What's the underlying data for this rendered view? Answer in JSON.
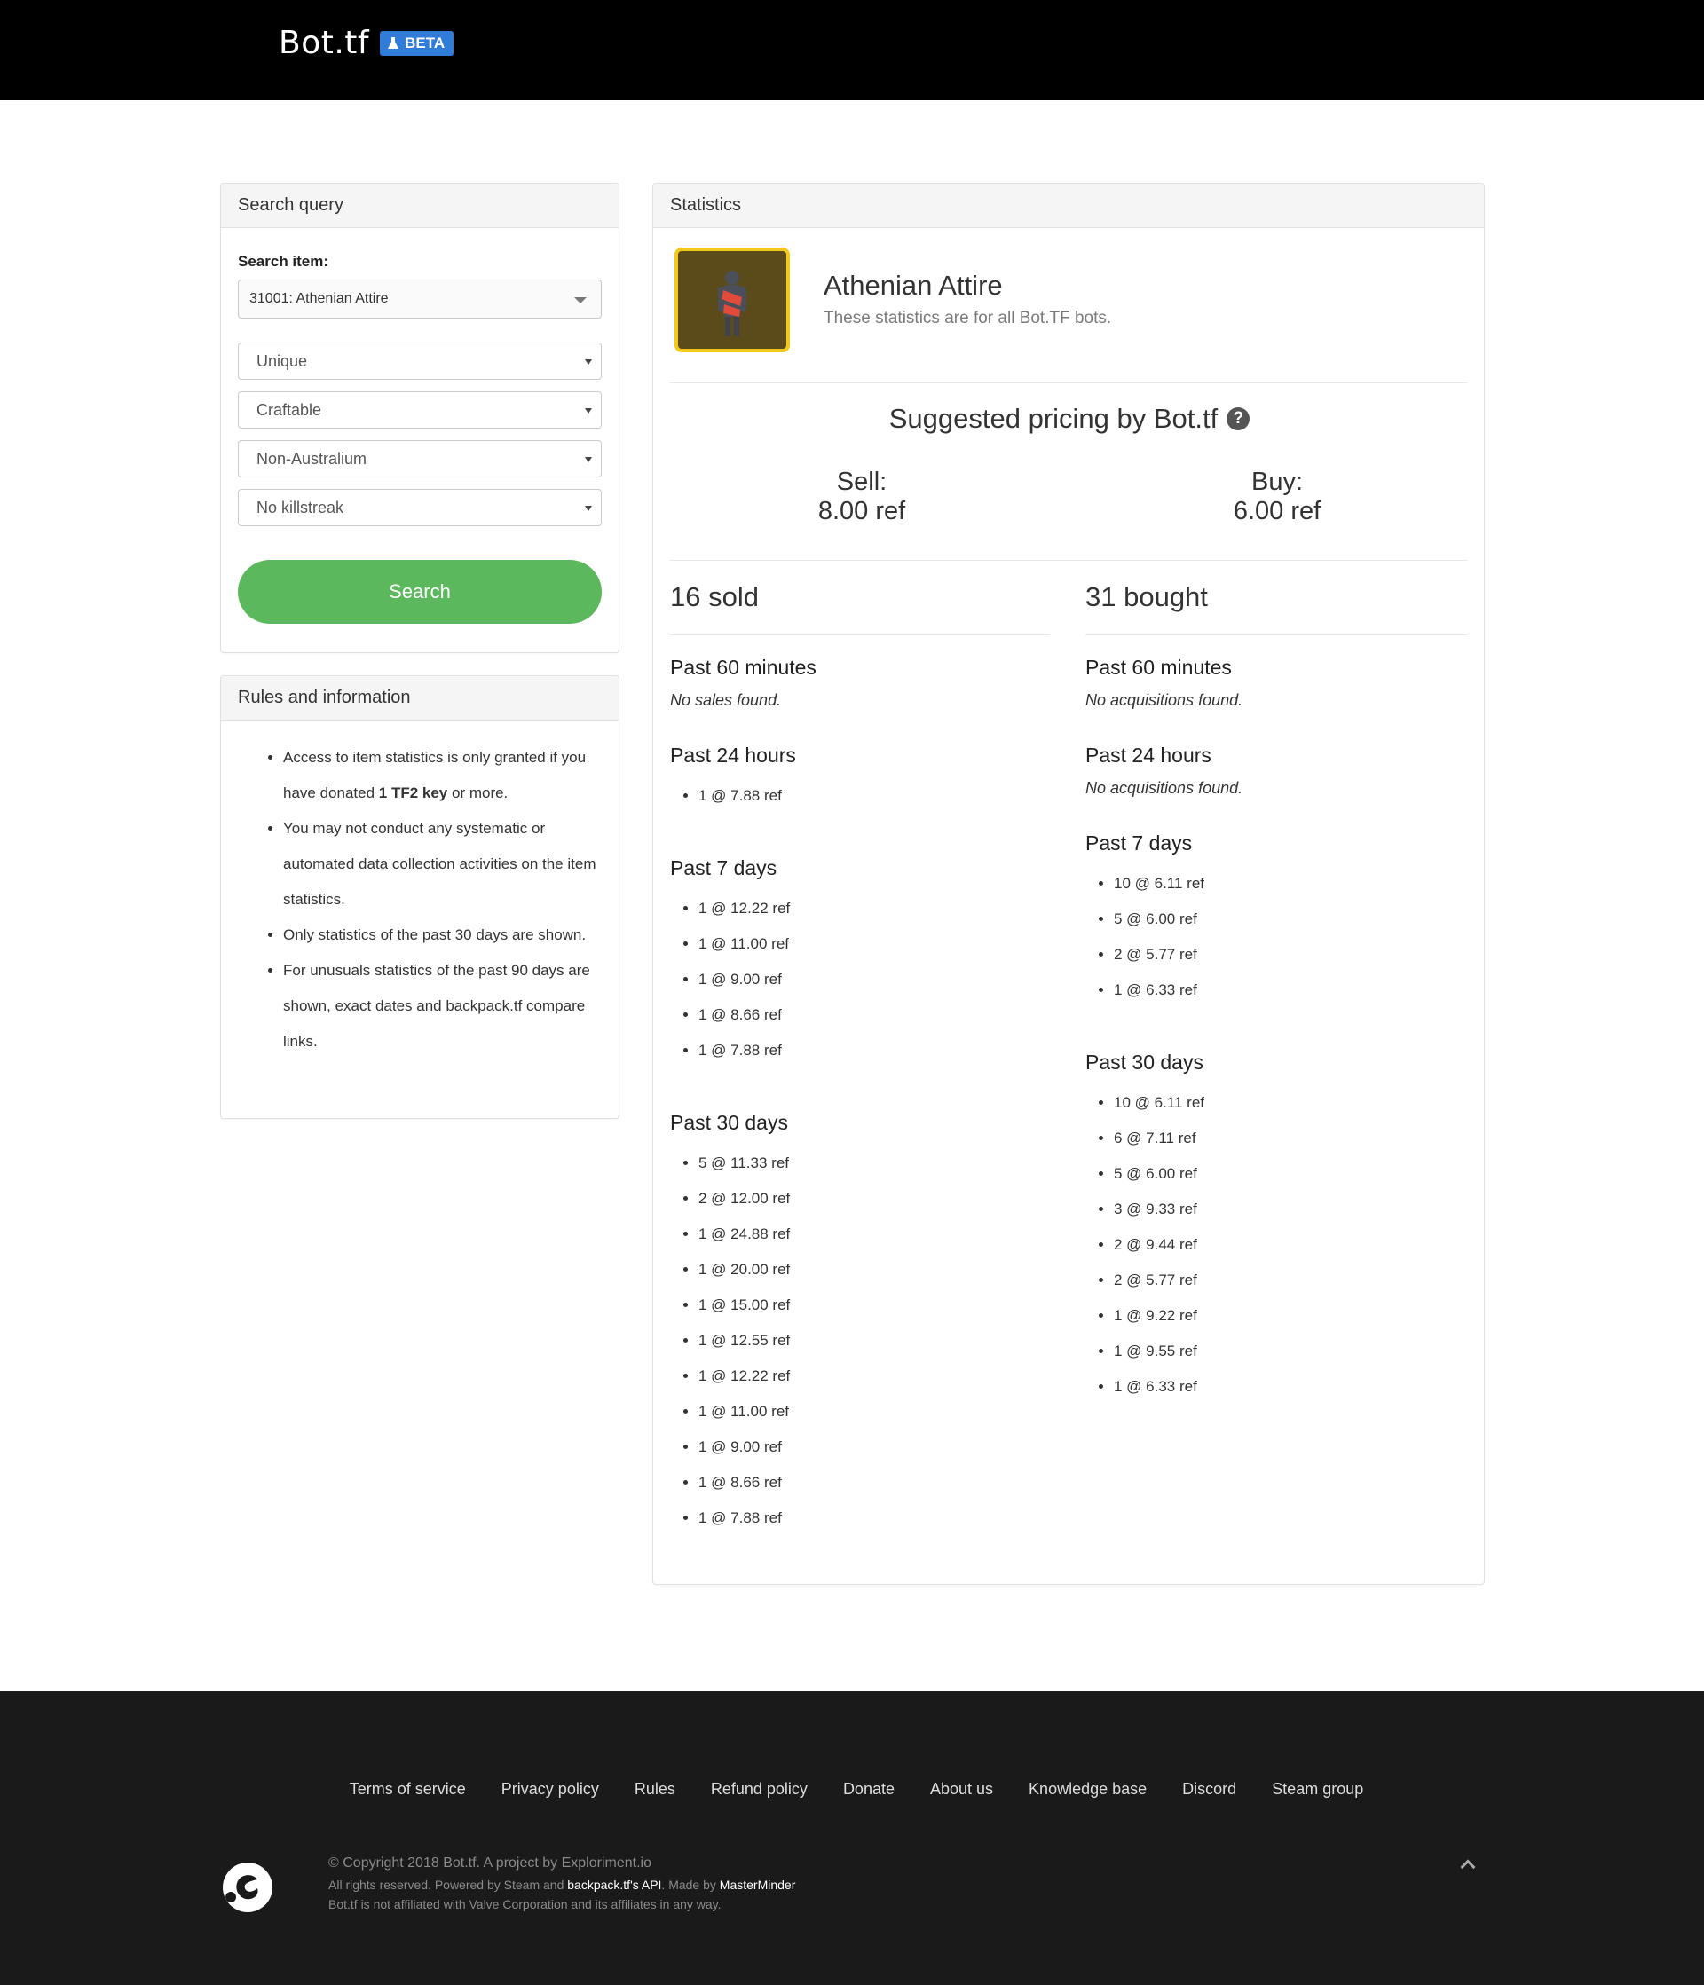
{
  "header": {
    "brand": "Bot.tf",
    "badge": "BETA"
  },
  "search": {
    "panel_title": "Search query",
    "item_label": "Search item:",
    "item_value": "31001: Athenian Attire",
    "quality": "Unique",
    "craftable": "Craftable",
    "australium": "Non-Australium",
    "killstreak": "No killstreak",
    "button": "Search"
  },
  "rules": {
    "panel_title": "Rules and information",
    "item1_pre": "Access to item statistics is only granted if you have donated ",
    "item1_bold": "1 TF2 key",
    "item1_post": " or more.",
    "item2": "You may not conduct any systematic or automated data collection activities on the item statistics.",
    "item3": "Only statistics of the past 30 days are shown.",
    "item4": "For unusuals statistics of the past 90 days are shown, exact dates and backpack.tf compare links."
  },
  "stats": {
    "panel_title": "Statistics",
    "item_name": "Athenian Attire",
    "item_sub": "These statistics are for all Bot.TF bots.",
    "suggest_title": "Suggested pricing by Bot.tf",
    "help_icon": "question-circle-icon",
    "sell_label": "Sell:",
    "sell_value": "8.00 ref",
    "buy_label": "Buy:",
    "buy_value": "6.00 ref",
    "sold": {
      "title": "16 sold",
      "p60_title": "Past 60 minutes",
      "p60_none": "No sales found.",
      "p24_title": "Past 24 hours",
      "p24": [
        "1 @ 7.88 ref"
      ],
      "p7_title": "Past 7 days",
      "p7": [
        "1 @ 12.22 ref",
        "1 @ 11.00 ref",
        "1 @ 9.00 ref",
        "1 @ 8.66 ref",
        "1 @ 7.88 ref"
      ],
      "p30_title": "Past 30 days",
      "p30": [
        "5 @ 11.33 ref",
        "2 @ 12.00 ref",
        "1 @ 24.88 ref",
        "1 @ 20.00 ref",
        "1 @ 15.00 ref",
        "1 @ 12.55 ref",
        "1 @ 12.22 ref",
        "1 @ 11.00 ref",
        "1 @ 9.00 ref",
        "1 @ 8.66 ref",
        "1 @ 7.88 ref"
      ]
    },
    "bought": {
      "title": "31 bought",
      "p60_title": "Past 60 minutes",
      "p60_none": "No acquisitions found.",
      "p24_title": "Past 24 hours",
      "p24_none": "No acquisitions found.",
      "p7_title": "Past 7 days",
      "p7": [
        "10 @ 6.11 ref",
        "5 @ 6.00 ref",
        "2 @ 5.77 ref",
        "1 @ 6.33 ref"
      ],
      "p30_title": "Past 30 days",
      "p30": [
        "10 @ 6.11 ref",
        "6 @ 7.11 ref",
        "5 @ 6.00 ref",
        "3 @ 9.33 ref",
        "2 @ 9.44 ref",
        "2 @ 5.77 ref",
        "1 @ 9.22 ref",
        "1 @ 9.55 ref",
        "1 @ 6.33 ref"
      ]
    }
  },
  "footer": {
    "links": [
      "Terms of service",
      "Privacy policy",
      "Rules",
      "Refund policy",
      "Donate",
      "About us",
      "Knowledge base",
      "Discord",
      "Steam group"
    ],
    "copyright": "© Copyright 2018 Bot.tf. A project by Exploriment.io",
    "line2_a": "All rights reserved. Powered by Steam and ",
    "line2_b": "backpack.tf's API",
    "line2_c": ". Made by ",
    "line2_d": "MasterMinder",
    "line3": "Bot.tf is not affiliated with Valve Corporation and its affiliates in any way."
  }
}
